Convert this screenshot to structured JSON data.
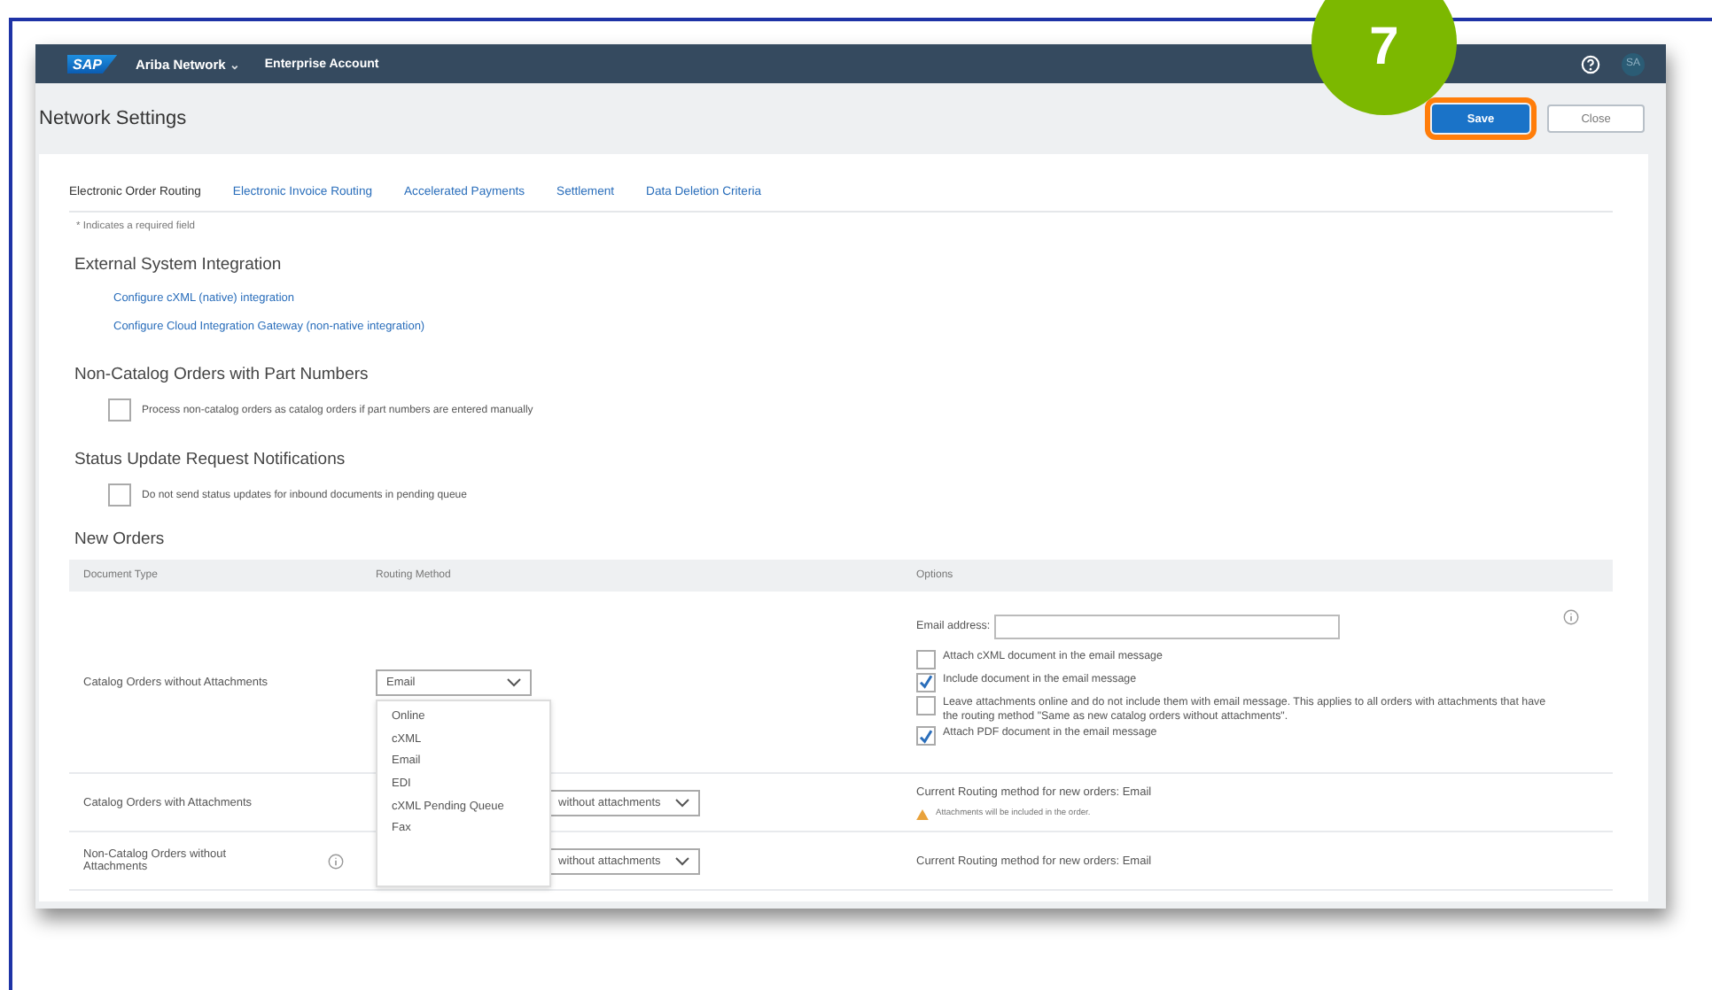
{
  "header": {
    "logo": "SAP",
    "product": "Ariba Network",
    "product_chevron": "⌄",
    "account": "Enterprise Account",
    "avatar": "SA"
  },
  "page_title": "Network Settings",
  "buttons": [
    {
      "label": "Save",
      "kind": "primary",
      "highlighted": true
    },
    {
      "label": "Close",
      "kind": "secondary",
      "highlighted": false
    }
  ],
  "step_badge": "7",
  "tabs": [
    {
      "label": "Electronic Order Routing",
      "selected": true
    },
    {
      "label": "Electronic Invoice Routing",
      "selected": false
    },
    {
      "label": "Accelerated Payments",
      "selected": false
    },
    {
      "label": "Settlement",
      "selected": false
    },
    {
      "label": "Data Deletion Criteria",
      "selected": false
    }
  ],
  "required_note": "* Indicates a required field",
  "sections": [
    {
      "title": "External System Integration",
      "kind": "links",
      "links": [
        "Configure cXML (native) integration",
        "Configure Cloud Integration Gateway (non-native integration)"
      ]
    },
    {
      "title": "Non-Catalog Orders with Part Numbers",
      "kind": "checkboxes",
      "items": [
        {
          "label": "Process non-catalog orders as catalog orders if part numbers are entered manually",
          "checked": false
        }
      ]
    },
    {
      "title": "Status Update Request Notifications",
      "kind": "checkboxes",
      "items": [
        {
          "label": "Do not send status updates for inbound documents in pending queue",
          "checked": false
        }
      ]
    }
  ],
  "new_orders": {
    "title": "New Orders",
    "columns": [
      "Document Type",
      "Routing Method",
      "Options"
    ],
    "rows": [
      {
        "kind": "email",
        "document_type": "Catalog Orders without Attachments",
        "info": false,
        "routing": "Email",
        "routing_menu": [
          {
            "label": "Online",
            "selected": false
          },
          {
            "label": "cXML",
            "selected": false
          },
          {
            "label": "Email",
            "selected": false
          },
          {
            "label": "EDI",
            "selected": false
          },
          {
            "label": "cXML Pending Queue",
            "selected": false
          },
          {
            "label": "Fax",
            "selected": false
          }
        ],
        "email_label": "Email address:",
        "options_info": true,
        "checkboxes": [
          {
            "label": "Attach cXML document in the email message",
            "checked": false
          },
          {
            "label": "Include document in the email message",
            "checked": true
          },
          {
            "label": "Leave attachments online and do not include them with email message.  This applies to all orders with attachments that have the routing method \"Same as new catalog orders without attachments\".",
            "checked": false
          },
          {
            "label": "Attach PDF document in the email message",
            "checked": true
          }
        ]
      },
      {
        "kind": "summary",
        "document_type": "Catalog Orders with Attachments",
        "info": false,
        "routing": "without attachments",
        "current": "Current Routing method for new orders: Email",
        "warning": "Attachments will be included in the order."
      },
      {
        "kind": "summary",
        "document_type": "Non-Catalog Orders without Attachments",
        "info": true,
        "routing": "without attachments",
        "current": "Current Routing method for new orders: Email"
      }
    ]
  }
}
